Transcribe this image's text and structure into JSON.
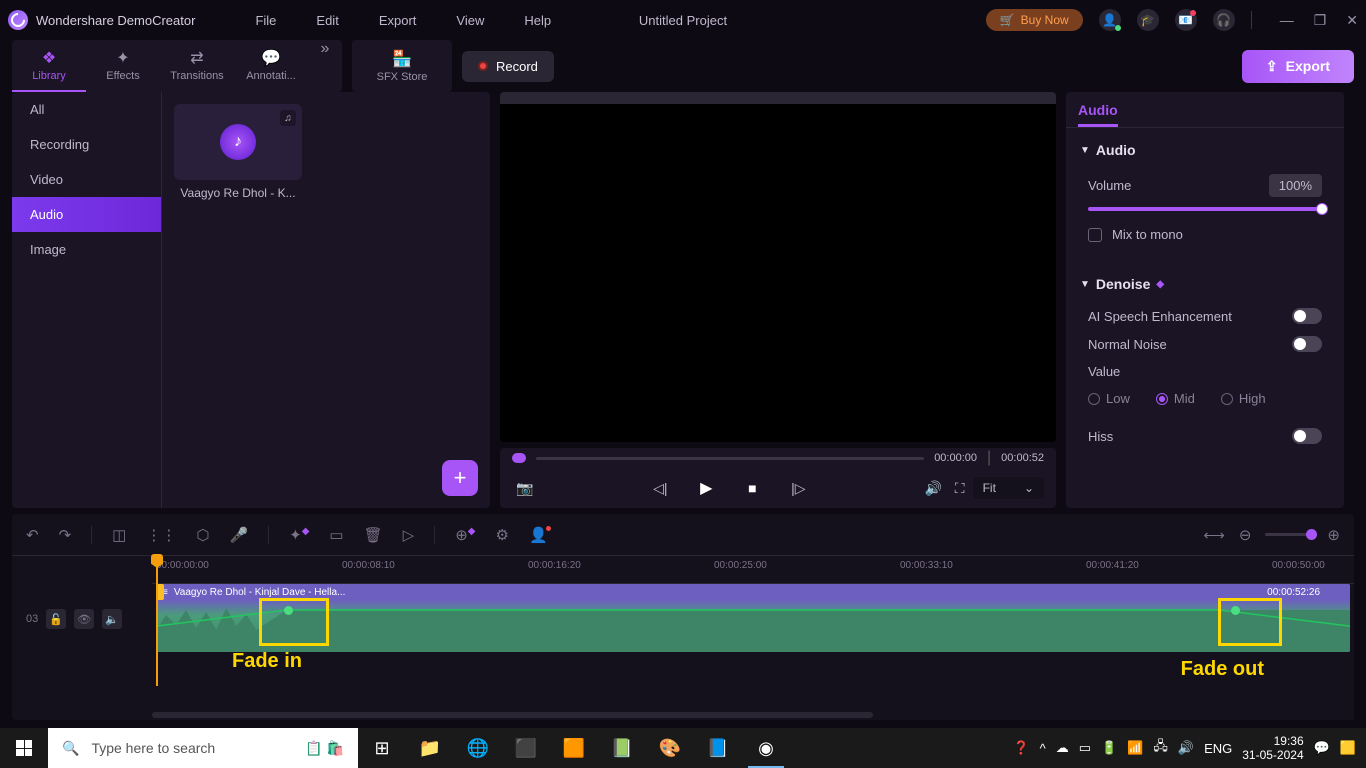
{
  "app": {
    "name": "Wondershare DemoCreator",
    "project": "Untitled Project"
  },
  "menu": [
    "File",
    "Edit",
    "Export",
    "View",
    "Help"
  ],
  "titlebar": {
    "buy": "Buy Now"
  },
  "toolTabs": [
    {
      "label": "Library",
      "icon": "❖",
      "active": true
    },
    {
      "label": "Effects",
      "icon": "✦"
    },
    {
      "label": "Transitions",
      "icon": "⇄"
    },
    {
      "label": "Annotati...",
      "icon": "💬"
    }
  ],
  "sfx": "SFX Store",
  "buttons": {
    "record": "Record",
    "export": "Export"
  },
  "librarySidebar": [
    "All",
    "Recording",
    "Video",
    "Audio",
    "Image"
  ],
  "librarySidebarActive": "Audio",
  "mediaItem": {
    "label": "Vaagyo Re Dhol - K..."
  },
  "preview": {
    "time": "00:00:00",
    "total": "00:00:52",
    "fit": "Fit"
  },
  "props": {
    "tab": "Audio",
    "sections": {
      "audio": {
        "title": "Audio",
        "volume_label": "Volume",
        "volume_value": "100%",
        "mix": "Mix to mono"
      },
      "denoise": {
        "title": "Denoise",
        "ai": "AI Speech Enhancement",
        "normal": "Normal Noise",
        "value_label": "Value",
        "low": "Low",
        "mid": "Mid",
        "high": "High",
        "hiss": "Hiss"
      }
    }
  },
  "timeline": {
    "marks": [
      "00:00:00:00",
      "00:00:08:10",
      "00:00:16:20",
      "00:00:25:00",
      "00:00:33:10",
      "00:00:41:20",
      "00:00:50:00"
    ],
    "trackNum": "03",
    "clip": {
      "title": "Vaagyo Re Dhol - Kinjal Dave - Hella...",
      "dur": "00:00:52:26"
    },
    "annotations": {
      "fadein": "Fade in",
      "fadeout": "Fade out"
    }
  },
  "taskbar": {
    "search": "Type here to search",
    "lang": "ENG",
    "time": "19:36",
    "date": "31-05-2024"
  }
}
